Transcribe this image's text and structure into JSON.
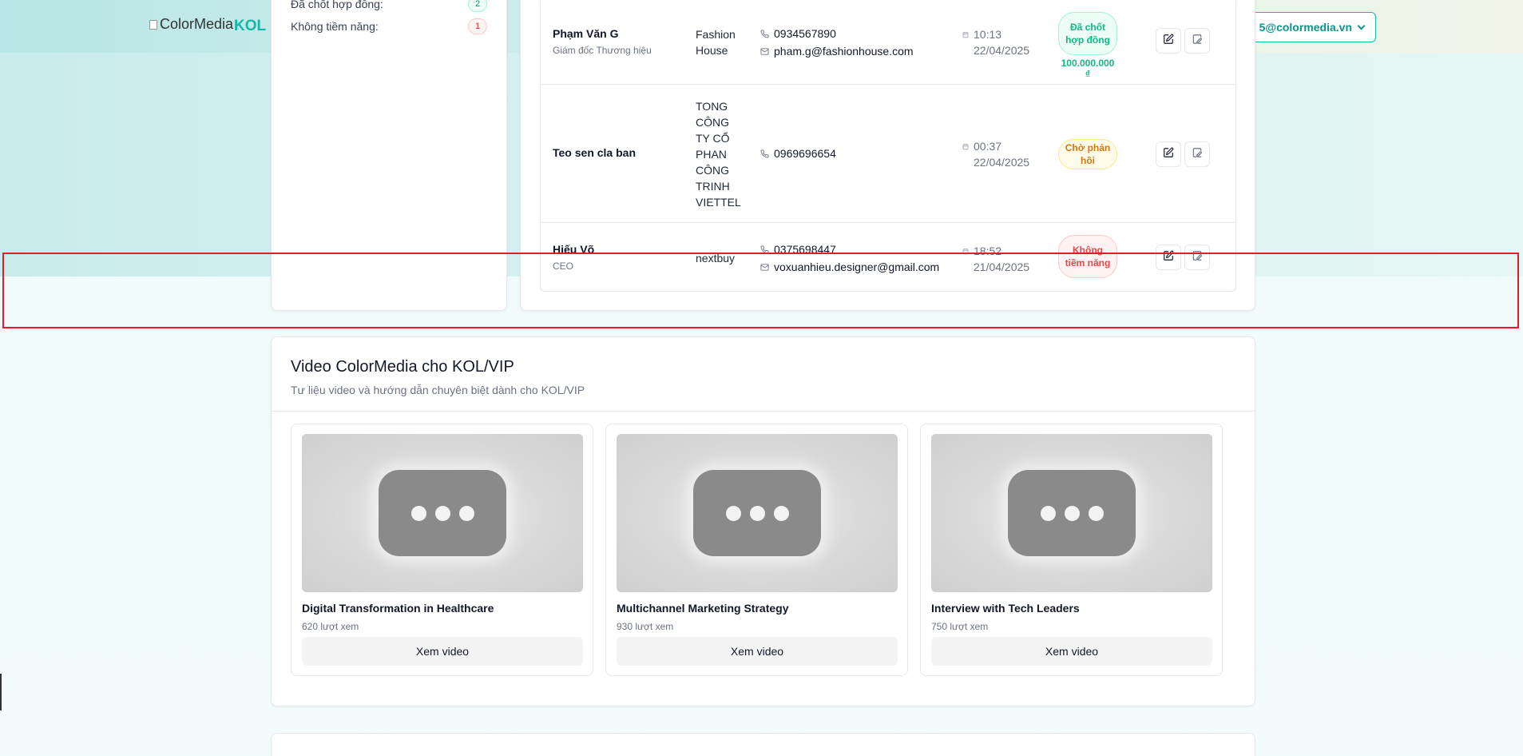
{
  "header": {
    "logo_alt": "ColorMedia",
    "brand": "KOL/VIP",
    "user_email": "5@colormedia.vn"
  },
  "summary": {
    "rows": [
      {
        "label": "Đã chốt hợp đồng:",
        "count": "2"
      },
      {
        "label": "Không tiềm năng:",
        "count": "1"
      }
    ]
  },
  "leads": [
    {
      "name": "Phạm Văn G",
      "title": "Giám đốc Thương hiệu",
      "company": "Fashion House",
      "phone": "0934567890",
      "email": "pham.g@fashionhouse.com",
      "time": "10:13",
      "date": "22/04/2025",
      "status": "Đã chốt hợp đồng",
      "amount": "100.000.000 ₫"
    },
    {
      "name": "Teo sen cla ban",
      "title": "",
      "company": "TONG CÔNG TY CỔ PHAN CÔNG TRINH VIETTEL",
      "phone": "0969696654",
      "email": "",
      "time": "00:37",
      "date": "22/04/2025",
      "status": "Chờ phản hồi",
      "amount": ""
    },
    {
      "name": "Hiếu Võ",
      "title": "CEO",
      "company": "nextbuy",
      "phone": "0375698447",
      "email": "voxuanhieu.designer@gmail.com",
      "time": "18:52",
      "date": "21/04/2025",
      "status": "Không tiềm năng",
      "amount": ""
    }
  ],
  "videos": {
    "title": "Video ColorMedia cho KOL/VIP",
    "subtitle": "Tư liệu video và hướng dẫn chuyên biệt dành cho KOL/VIP",
    "items": [
      {
        "title": "Digital Transformation in Healthcare",
        "views": "620 lượt xem",
        "button": "Xem video"
      },
      {
        "title": "Multichannel Marketing Strategy",
        "views": "930 lượt xem",
        "button": "Xem video"
      },
      {
        "title": "Interview with Tech Leaders",
        "views": "750 lượt xem",
        "button": "Xem video"
      }
    ]
  },
  "colors": {
    "accent": "#14b8a6",
    "status_success": "#10b981",
    "status_pending": "#d97706",
    "status_negative": "#ef4444",
    "highlight": "#e11d2a"
  },
  "icons": [
    "phone-icon",
    "mail-icon",
    "calendar-icon",
    "edit-icon",
    "note-icon",
    "chevron-down-icon",
    "play-placeholder-icon"
  ]
}
